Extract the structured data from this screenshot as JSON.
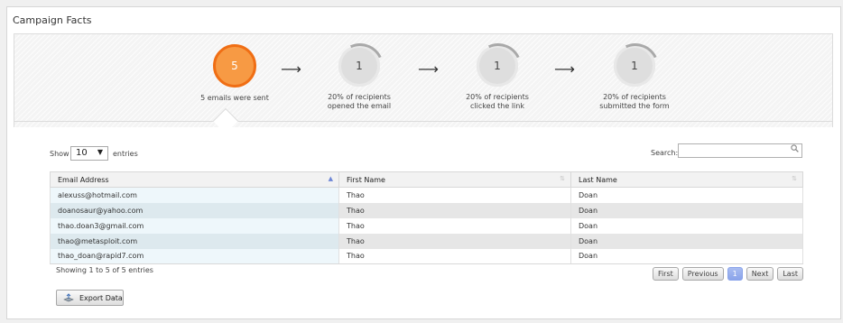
{
  "panel": {
    "title": "Campaign Facts"
  },
  "funnel": {
    "steps": [
      {
        "count": "5",
        "line1": "5 emails were sent",
        "line2": ""
      },
      {
        "count": "1",
        "line1": "20% of recipients",
        "line2": "opened the email"
      },
      {
        "count": "1",
        "line1": "20% of recipients",
        "line2": "clicked the link"
      },
      {
        "count": "1",
        "line1": "20% of recipients",
        "line2": "submitted the form"
      }
    ],
    "arrow": "⟶",
    "colors": {
      "active_fill": "#f79a44",
      "active_border": "#f06e14",
      "inactive_fill": "#dedede"
    }
  },
  "table_controls": {
    "show_label": "Show",
    "page_size": "10",
    "entries_label": "entries",
    "search_label": "Search:",
    "search_value": ""
  },
  "table": {
    "columns": [
      "Email Address",
      "First Name",
      "Last Name"
    ],
    "rows": [
      [
        "alexuss@hotmail.com",
        "Thao",
        "Doan"
      ],
      [
        "doanosaur@yahoo.com",
        "Thao",
        "Doan"
      ],
      [
        "thao.doan3@gmail.com",
        "Thao",
        "Doan"
      ],
      [
        "thao@metasploit.com",
        "Thao",
        "Doan"
      ],
      [
        "thao_doan@rapid7.com",
        "Thao",
        "Doan"
      ]
    ]
  },
  "footer": {
    "info": "Showing 1 to 5 of 5 entries",
    "pager": {
      "first": "First",
      "previous": "Previous",
      "current": "1",
      "next": "Next",
      "last": "Last"
    },
    "export_label": "Export Data"
  }
}
